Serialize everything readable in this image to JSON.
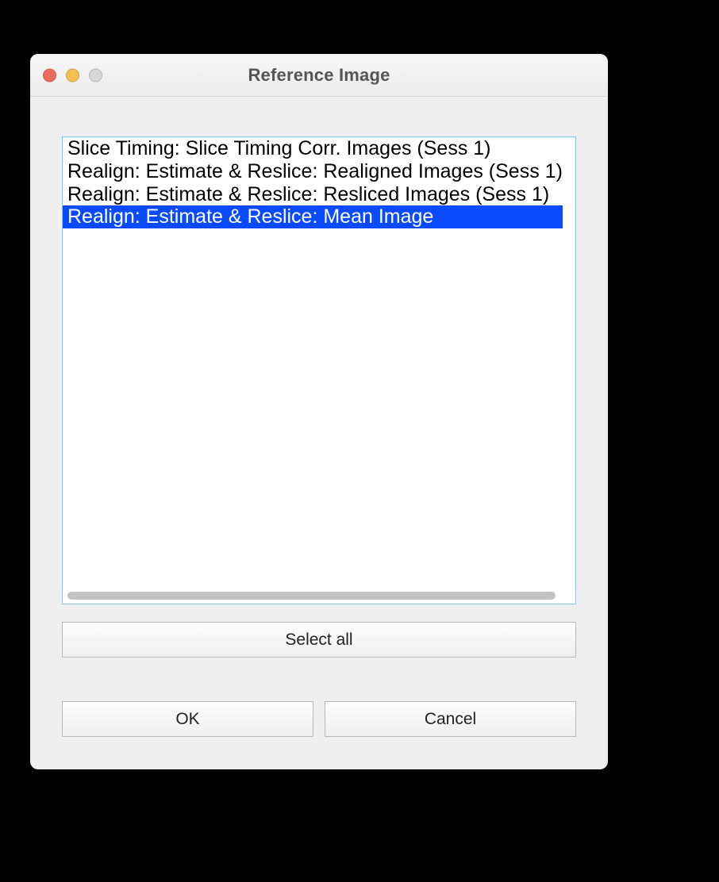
{
  "window": {
    "title": "Reference Image"
  },
  "listbox": {
    "items": [
      {
        "label": "Slice Timing: Slice Timing Corr. Images (Sess 1)",
        "selected": false
      },
      {
        "label": "Realign: Estimate & Reslice: Realigned Images (Sess 1)",
        "selected": false
      },
      {
        "label": "Realign: Estimate & Reslice: Resliced Images (Sess 1)",
        "selected": false
      },
      {
        "label": "Realign: Estimate & Reslice: Mean Image",
        "selected": true
      }
    ]
  },
  "buttons": {
    "select_all": "Select all",
    "ok": "OK",
    "cancel": "Cancel"
  }
}
